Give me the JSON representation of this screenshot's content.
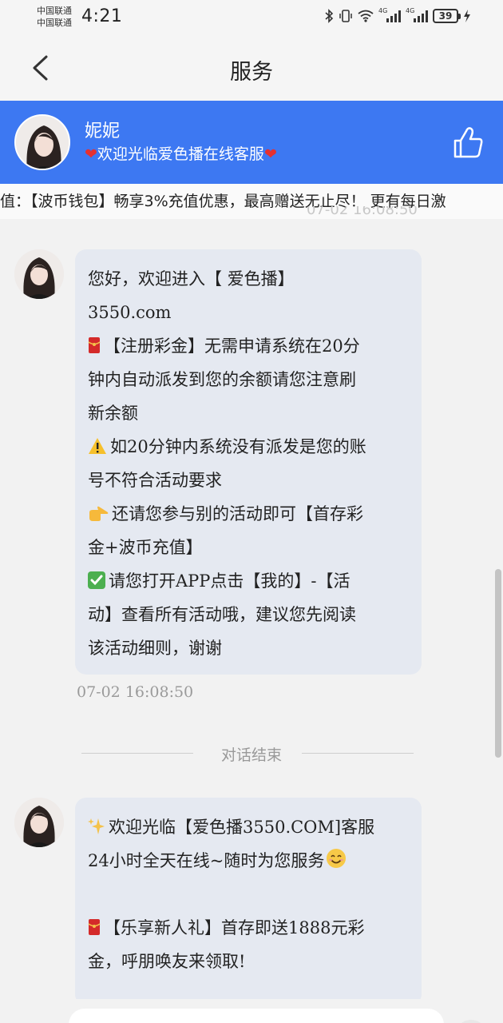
{
  "status_bar": {
    "carrier_1": "中国联通",
    "carrier_2": "中国联通",
    "time": "4:21",
    "network_1": "4G",
    "network_2": "4G",
    "battery": "39"
  },
  "header": {
    "title": "服务"
  },
  "agent": {
    "name": "妮妮",
    "greeting": "欢迎光临爱色播在线客服",
    "heart_left": "❤",
    "heart_right": "❤"
  },
  "marquee": {
    "text": "值：【波币钱包】畅享3%充值优惠，最高赠送无止尽！ 更有每日激"
  },
  "chat": {
    "cut_timestamp": "07-02 16:08:50",
    "messages": [
      {
        "lines": [
          "您好，欢迎进入【 爱色播】",
          "3550.com",
          "【注册彩金】无需申请系统在20分",
          "钟内自动派发到您的余额请您注意刷",
          "新余额",
          "如20分钟内系统没有派发是您的账",
          "号不符合活动要求",
          "还请您参与别的活动即可【首存彩",
          "金+波币充值】",
          "请您打开APP点击【我的】-【活",
          "动】查看所有活动哦，建议您先阅读",
          "该活动细则，谢谢"
        ],
        "timestamp": "07-02 16:08:50"
      },
      {
        "lines": [
          "欢迎光临【爱色播3550.COM]客服",
          "24小时全天在线~随时为您服务",
          "",
          "【乐享新人礼】首存即送1888元彩",
          "金，呼朋唤友来领取!"
        ]
      }
    ],
    "divider_label": "对话结束"
  },
  "icons": {
    "back": "chevron-left-icon",
    "like": "thumbs-up-icon",
    "red_envelope": "red-envelope-icon",
    "warning": "warning-icon",
    "pointing_hand": "pointing-hand-icon",
    "check": "check-mark-icon",
    "sparkles": "sparkles-icon",
    "smile": "smiling-face-icon"
  },
  "colors": {
    "banner": "#3d78f2",
    "bubble": "#e5e9f1",
    "background": "#f2f2f2"
  }
}
